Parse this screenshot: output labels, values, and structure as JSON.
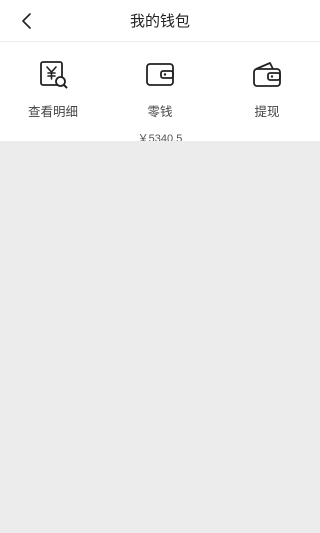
{
  "header": {
    "title": "我的钱包",
    "back_icon": "chevron-left-icon"
  },
  "actions": [
    {
      "label": "查看明细",
      "icon": "bill-search-icon"
    },
    {
      "label": "零钱",
      "icon": "wallet-icon",
      "balance": "￥5340.5"
    },
    {
      "label": "提现",
      "icon": "withdraw-wallet-icon"
    }
  ],
  "colors": {
    "background": "#ffffff",
    "content_background": "#ececec",
    "icon_stroke": "#222222"
  }
}
